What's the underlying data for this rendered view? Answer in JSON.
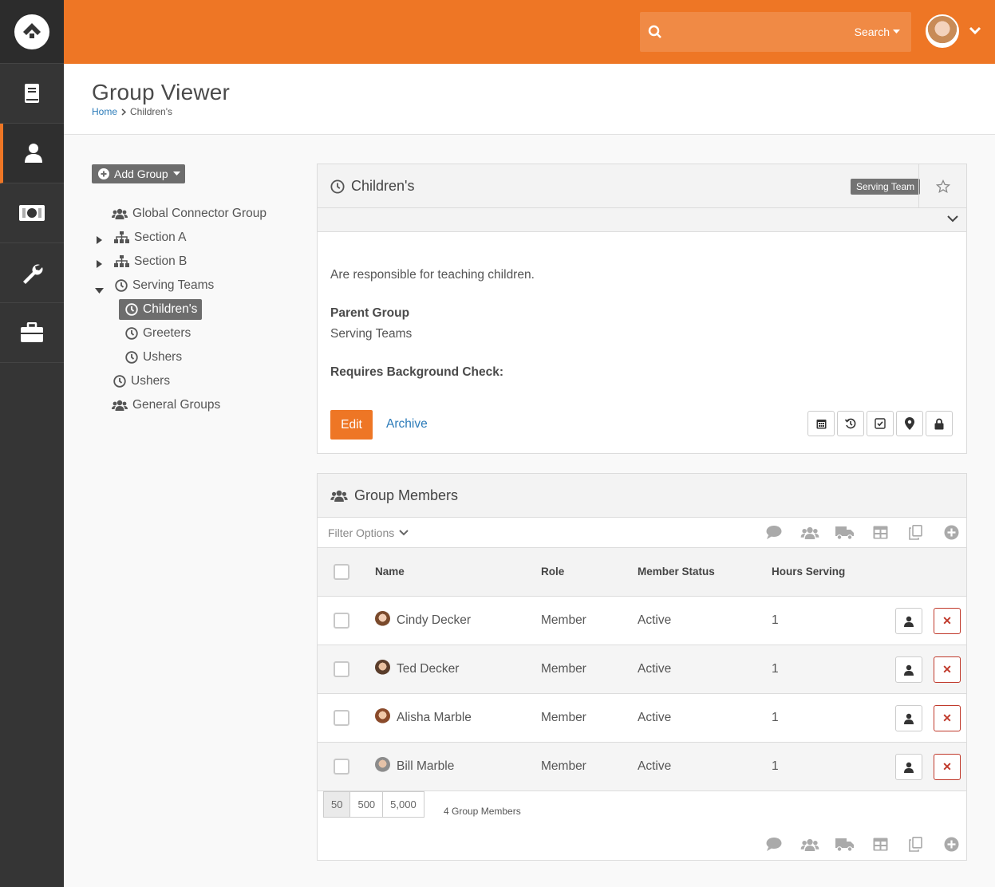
{
  "search": {
    "placeholder": "",
    "button_label": "Search"
  },
  "header": {
    "title": "Group Viewer",
    "breadcrumb": [
      "Home",
      "Children's"
    ]
  },
  "tree": {
    "add_group_label": "Add Group",
    "items": [
      {
        "label": "Global Connector Group",
        "icon": "users-icon"
      },
      {
        "label": "Section A",
        "icon": "sitemap-icon",
        "expanded": false
      },
      {
        "label": "Section B",
        "icon": "sitemap-icon",
        "expanded": false
      },
      {
        "label": "Serving Teams",
        "icon": "clock-icon",
        "expanded": true
      },
      {
        "label": "Children's",
        "icon": "clock-icon",
        "selected": true
      },
      {
        "label": "Greeters",
        "icon": "clock-icon"
      },
      {
        "label": "Ushers",
        "icon": "clock-icon"
      },
      {
        "label": "Ushers",
        "icon": "clock-icon"
      },
      {
        "label": "General Groups",
        "icon": "users-icon"
      }
    ]
  },
  "group_panel": {
    "title": "Children's",
    "badge": "Serving Team",
    "description": "Are responsible for teaching children.",
    "parent_group_label": "Parent Group",
    "parent_group_value": "Serving Teams",
    "background_check_label": "Requires Background Check:",
    "edit_label": "Edit",
    "archive_label": "Archive"
  },
  "members_panel": {
    "title": "Group Members",
    "filter_label": "Filter Options",
    "columns": [
      "Name",
      "Role",
      "Member Status",
      "Hours Serving"
    ],
    "rows": [
      {
        "name": "Cindy Decker",
        "role": "Member",
        "status": "Active",
        "hours": "1"
      },
      {
        "name": "Ted Decker",
        "role": "Member",
        "status": "Active",
        "hours": "1"
      },
      {
        "name": "Alisha Marble",
        "role": "Member",
        "status": "Active",
        "hours": "1"
      },
      {
        "name": "Bill Marble",
        "role": "Member",
        "status": "Active",
        "hours": "1"
      }
    ],
    "page_sizes": [
      "50",
      "500",
      "5,000"
    ],
    "count_label": "4 Group Members"
  },
  "colors": {
    "accent": "#ee7625",
    "sidebar": "#353535",
    "link": "#2b7bb9",
    "danger": "#c0392b"
  }
}
